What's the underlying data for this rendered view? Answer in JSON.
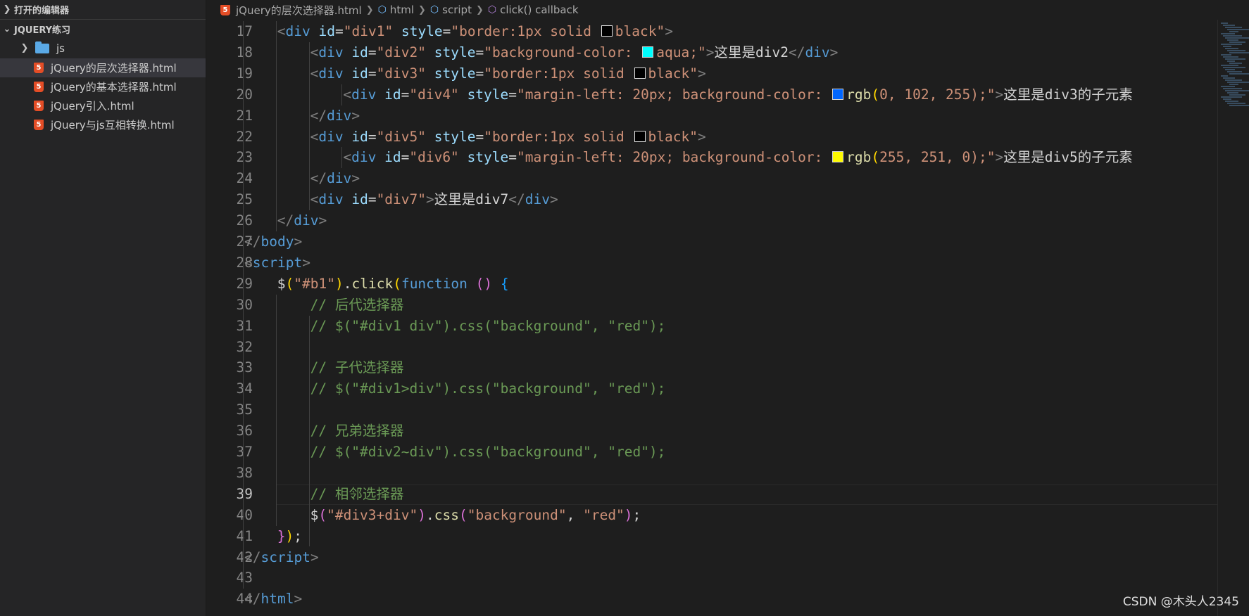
{
  "sidebar": {
    "open_editors_label": "打开的编辑器",
    "workspace_label": "JQUERY练习",
    "folder": {
      "label": "js",
      "icon": "folder-icon"
    },
    "files": [
      {
        "label": "jQuery的层次选择器.html",
        "icon": "html5-icon",
        "active": true
      },
      {
        "label": "jQuery的基本选择器.html",
        "icon": "html5-icon",
        "active": false
      },
      {
        "label": "jQuery引入.html",
        "icon": "html5-icon",
        "active": false
      },
      {
        "label": "jQuery与js互相转换.html",
        "icon": "html5-icon",
        "active": false
      }
    ]
  },
  "breadcrumb": {
    "file": "jQuery的层次选择器.html",
    "items": [
      "html",
      "script",
      "click() callback"
    ]
  },
  "editor": {
    "current_line": "39",
    "swatch_colors": {
      "black": "#000000",
      "aqua": "#00ffff",
      "blue": "#0066ff",
      "yellow": "#fffb00"
    },
    "lines": [
      {
        "n": "17",
        "tokens": [
          "<",
          "div",
          " ",
          "id",
          "=",
          "\"div1\"",
          " ",
          "style",
          "=",
          "\"border:1px solid ",
          "black",
          "\"",
          ">"
        ]
      },
      {
        "n": "18",
        "tokens": [
          "<",
          "div",
          " ",
          "id",
          "=",
          "\"div2\"",
          " ",
          "style",
          "=",
          "\"background-color: ",
          "aqua;",
          "\"",
          ">",
          "这里是div2",
          "</",
          "div",
          ">"
        ]
      },
      {
        "n": "19",
        "tokens": [
          "<",
          "div",
          " ",
          "id",
          "=",
          "\"div3\"",
          " ",
          "style",
          "=",
          "\"border:1px solid ",
          "black",
          "\"",
          ">"
        ]
      },
      {
        "n": "20",
        "tokens": [
          "<",
          "div",
          " ",
          "id",
          "=",
          "\"div4\"",
          " ",
          "style",
          "=",
          "\"margin-left: 20px; background-color: ",
          "rgb",
          "(",
          "0, 102, 255",
          ");",
          "\"",
          ">",
          "这里是div3的子元素"
        ]
      },
      {
        "n": "21",
        "tokens": [
          "</",
          "div",
          ">"
        ]
      },
      {
        "n": "22",
        "tokens": [
          "<",
          "div",
          " ",
          "id",
          "=",
          "\"div5\"",
          " ",
          "style",
          "=",
          "\"border:1px solid ",
          "black",
          "\"",
          ">"
        ]
      },
      {
        "n": "23",
        "tokens": [
          "<",
          "div",
          " ",
          "id",
          "=",
          "\"div6\"",
          " ",
          "style",
          "=",
          "\"margin-left: 20px; background-color: ",
          "rgb",
          "(",
          "255, 251, 0",
          ");",
          "\"",
          ">",
          "这里是div5的子元素"
        ]
      },
      {
        "n": "24",
        "tokens": [
          "</",
          "div",
          ">"
        ]
      },
      {
        "n": "25",
        "tokens": [
          "<",
          "div",
          " ",
          "id",
          "=",
          "\"div7\"",
          ">",
          "这里是div7",
          "</",
          "div",
          ">"
        ]
      },
      {
        "n": "26",
        "tokens": [
          "</",
          "div",
          ">"
        ]
      },
      {
        "n": "27",
        "tokens": [
          "</",
          "body",
          ">"
        ]
      },
      {
        "n": "28",
        "tokens": [
          "<",
          "script",
          ">"
        ]
      },
      {
        "n": "29",
        "tokens": [
          "$",
          "(",
          "\"#b1\"",
          ")",
          ".",
          "click",
          "(",
          "function",
          " ",
          "()",
          " ",
          "{"
        ]
      },
      {
        "n": "30",
        "tokens": [
          "// 后代选择器"
        ]
      },
      {
        "n": "31",
        "tokens": [
          "// $(\"#div1 div\").css(\"background\", \"red\");"
        ]
      },
      {
        "n": "32",
        "tokens": [
          ""
        ]
      },
      {
        "n": "33",
        "tokens": [
          "// 子代选择器"
        ]
      },
      {
        "n": "34",
        "tokens": [
          "// $(\"#div1>div\").css(\"background\", \"red\");"
        ]
      },
      {
        "n": "35",
        "tokens": [
          ""
        ]
      },
      {
        "n": "36",
        "tokens": [
          "// 兄弟选择器"
        ]
      },
      {
        "n": "37",
        "tokens": [
          "// $(\"#div2~div\").css(\"background\", \"red\");"
        ]
      },
      {
        "n": "38",
        "tokens": [
          ""
        ]
      },
      {
        "n": "39",
        "tokens": [
          "// 相邻选择器"
        ]
      },
      {
        "n": "40",
        "tokens": [
          "$",
          "(",
          "\"#div3+div\"",
          ")",
          ".",
          "css",
          "(",
          "\"background\"",
          ", ",
          "\"red\"",
          ")",
          ";"
        ]
      },
      {
        "n": "41",
        "tokens": [
          "}",
          ")",
          ";"
        ]
      },
      {
        "n": "42",
        "tokens": [
          "</",
          "script",
          ">"
        ]
      },
      {
        "n": "43",
        "tokens": [
          ""
        ]
      },
      {
        "n": "44",
        "tokens": [
          "</",
          "html",
          ">"
        ]
      }
    ]
  },
  "watermark": "CSDN @木头人2345"
}
